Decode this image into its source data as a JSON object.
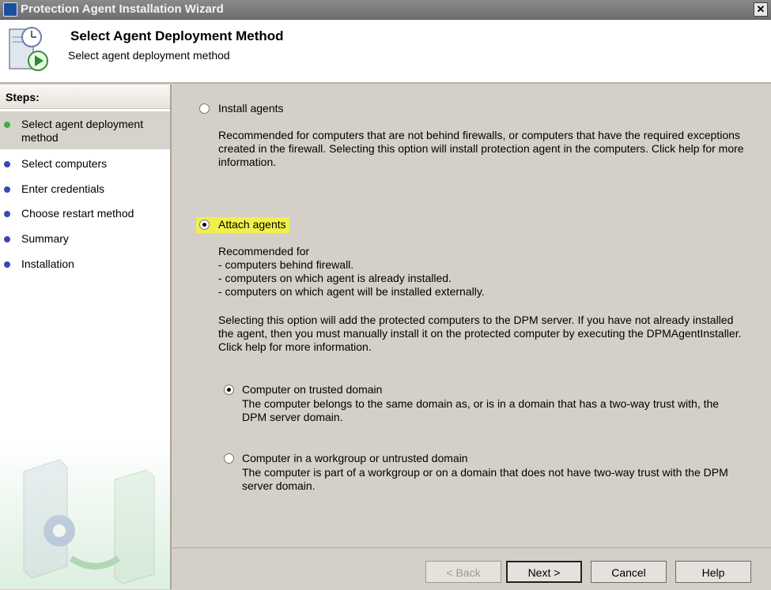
{
  "window": {
    "title": "Protection Agent Installation Wizard",
    "close_glyph": "✕",
    "icon": "clock-icon"
  },
  "header": {
    "title": "Select Agent Deployment Method",
    "subtitle": "Select agent deployment method",
    "icon": "agent-install-icon"
  },
  "sidebar": {
    "title": "Steps:",
    "steps": [
      {
        "label": "Select agent deployment method",
        "active": true
      },
      {
        "label": "Select computers",
        "active": false
      },
      {
        "label": "Enter credentials",
        "active": false
      },
      {
        "label": "Choose restart method",
        "active": false
      },
      {
        "label": "Summary",
        "active": false
      },
      {
        "label": "Installation",
        "active": false
      }
    ]
  },
  "main": {
    "install_agents": {
      "label": "Install agents",
      "selected": false,
      "description": "Recommended for computers that are not behind firewalls, or computers that have the required exceptions created in the firewall. Selecting this option will install protection agent in the computers. Click help for more information."
    },
    "attach_agents": {
      "label": "Attach agents",
      "selected": true,
      "highlight_color": "#f0f04a",
      "recommended_lines": [
        "Recommended for",
        "- computers behind firewall.",
        "- computers on which agent is already installed.",
        "- computers on which agent will be installed externally."
      ],
      "description": "Selecting this option will add the protected computers to the DPM server. If you have not already installed the agent, then you must manually install it on the protected computer by executing the DPMAgentInstaller. Click help for more information."
    },
    "trusted_domain": {
      "label": "Computer on trusted domain",
      "selected": true,
      "description": "The computer belongs to the same domain as, or is in a domain that has a two-way trust with, the DPM server domain."
    },
    "workgroup": {
      "label": "Computer in a workgroup or untrusted domain",
      "selected": false,
      "description": "The computer is part of a workgroup or on a domain that does not have two-way trust with the DPM server domain."
    }
  },
  "footer": {
    "back_label": "< Back",
    "next_label": "Next >",
    "cancel_label": "Cancel",
    "help_label": "Help",
    "back_enabled": false
  }
}
